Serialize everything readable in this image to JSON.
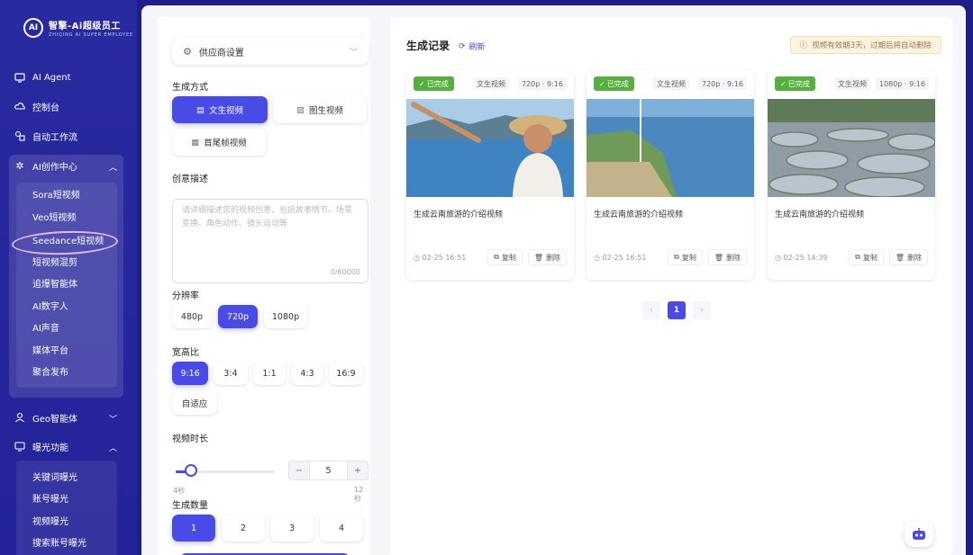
{
  "brand": {
    "mark": "AI",
    "title": "智擎-Ai超级员工",
    "subtitle": "ZHIQING AI SUPER EMPLOYEE"
  },
  "sidebar": {
    "items": [
      {
        "label": "AI Agent",
        "icon": "monitor-icon"
      },
      {
        "label": "控制台",
        "icon": "cloud-icon"
      },
      {
        "label": "自动工作流",
        "icon": "workflow-icon"
      },
      {
        "label": "AI创作中心",
        "icon": "sparkle-icon",
        "expanded": true
      },
      {
        "label": "Geo智能体",
        "icon": "user-icon",
        "expanded": false
      },
      {
        "label": "曝光功能",
        "icon": "chart-icon",
        "expanded": true
      }
    ],
    "ai_sub": [
      "Sora短视频",
      "Veo短视频",
      "Seedance短视频",
      "短视频混剪",
      "追爆智能体",
      "AI数字人",
      "AI声音",
      "媒体平台",
      "聚合发布"
    ],
    "exposure_sub": [
      "关键词曝光",
      "账号曝光",
      "视频曝光",
      "搜索账号曝光"
    ]
  },
  "form": {
    "provider": "供应商设置",
    "mode_label": "生成方式",
    "modes": [
      "文生视频",
      "图生视频",
      "首尾帧视频"
    ],
    "mode_active": "文生视频",
    "desc_label": "创意描述",
    "desc_placeholder": "请详细描述您的视频创意，包括故事情节、场景变换、角色动作、镜头运动等",
    "desc_counter": "0/60000",
    "res_label": "分辨率",
    "resolutions": [
      "480p",
      "720p",
      "1080p"
    ],
    "ratio_label": "宽高比",
    "ratios": [
      "9:16",
      "3:4",
      "1:1",
      "4:3",
      "16:9",
      "自适应"
    ],
    "duration_label": "视频时长",
    "duration_min": "4秒",
    "duration_max": "12秒",
    "duration_value": "5",
    "duration_fraction": 0.125,
    "count_label": "生成数量",
    "counts": [
      "1",
      "2",
      "3",
      "4"
    ]
  },
  "records": {
    "title": "生成记录",
    "refresh": "刷新",
    "notice": "视频有效期3天，过期后将自动删除",
    "cards": [
      {
        "status": "已完成",
        "type": "文生视频",
        "spec": "720p · 9:16",
        "desc": "生成云南旅游的介绍视频",
        "time": "02-25 16:51",
        "copy": "复制",
        "del": "删除"
      },
      {
        "status": "已完成",
        "type": "文生视频",
        "spec": "720p · 9:16",
        "desc": "生成云南旅游的介绍视频",
        "time": "02-25 16:51",
        "copy": "复制",
        "del": "删除"
      },
      {
        "status": "已完成",
        "type": "文生视频",
        "spec": "1080p · 9:16",
        "desc": "生成云南旅游的介绍视频",
        "time": "02-25 14:39",
        "copy": "复制",
        "del": "删除"
      }
    ],
    "page": "1"
  },
  "colors": {
    "accent": "#4a4ae6",
    "sidebar": "#2a2aa0",
    "success": "#55b03d"
  }
}
